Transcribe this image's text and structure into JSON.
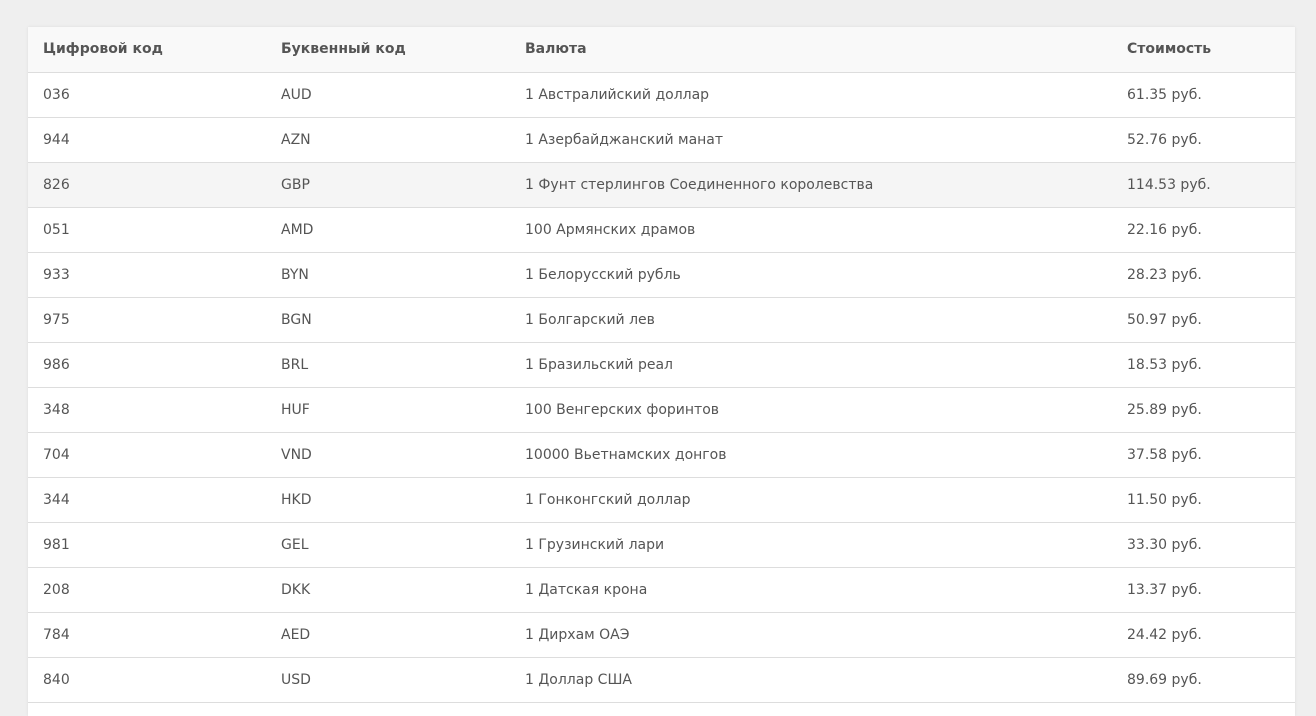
{
  "table": {
    "headers": [
      "Цифровой код",
      "Буквенный код",
      "Валюта",
      "Стоимость"
    ],
    "rows": [
      {
        "num": "036",
        "code": "AUD",
        "name": "1 Австралийский доллар",
        "price": "61.35 руб."
      },
      {
        "num": "944",
        "code": "AZN",
        "name": "1 Азербайджанский манат",
        "price": "52.76 руб."
      },
      {
        "num": "826",
        "code": "GBP",
        "name": "1 Фунт стерлингов Соединенного королевства",
        "price": "114.53 руб."
      },
      {
        "num": "051",
        "code": "AMD",
        "name": "100 Армянских драмов",
        "price": "22.16 руб."
      },
      {
        "num": "933",
        "code": "BYN",
        "name": "1 Белорусский рубль",
        "price": "28.23 руб."
      },
      {
        "num": "975",
        "code": "BGN",
        "name": "1 Болгарский лев",
        "price": "50.97 руб."
      },
      {
        "num": "986",
        "code": "BRL",
        "name": "1 Бразильский реал",
        "price": "18.53 руб."
      },
      {
        "num": "348",
        "code": "HUF",
        "name": "100 Венгерских форинтов",
        "price": "25.89 руб."
      },
      {
        "num": "704",
        "code": "VND",
        "name": "10000 Вьетнамских донгов",
        "price": "37.58 руб."
      },
      {
        "num": "344",
        "code": "HKD",
        "name": "1 Гонконгский доллар",
        "price": "11.50 руб."
      },
      {
        "num": "981",
        "code": "GEL",
        "name": "1 Грузинский лари",
        "price": "33.30 руб."
      },
      {
        "num": "208",
        "code": "DKK",
        "name": "1 Датская крона",
        "price": "13.37 руб."
      },
      {
        "num": "784",
        "code": "AED",
        "name": "1 Дирхам ОАЭ",
        "price": "24.42 руб."
      },
      {
        "num": "840",
        "code": "USD",
        "name": "1 Доллар США",
        "price": "89.69 руб."
      }
    ]
  }
}
